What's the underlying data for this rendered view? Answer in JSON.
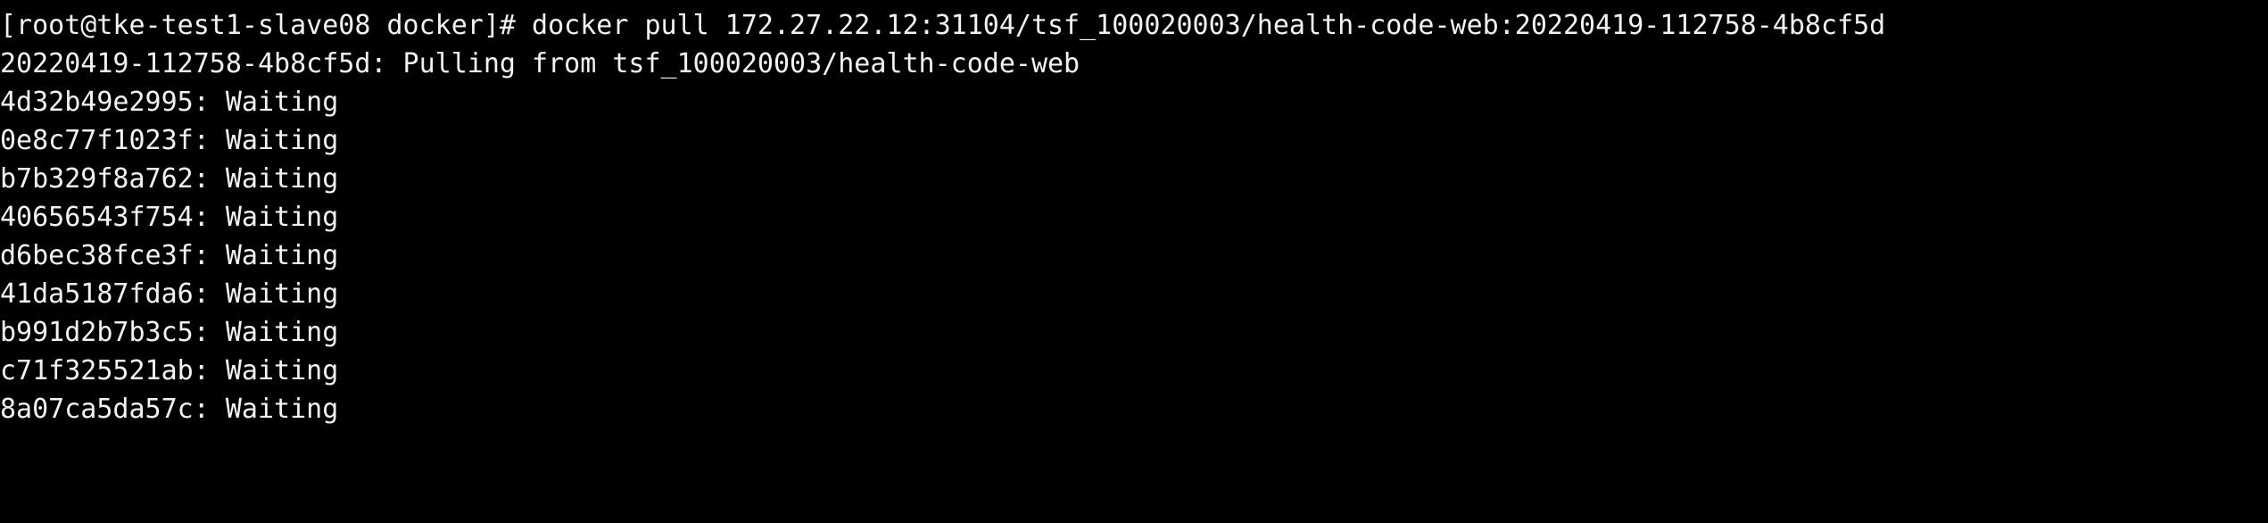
{
  "terminal": {
    "prompt": "[root@tke-test1-slave08 docker]# ",
    "command": "docker pull 172.27.22.12:31104/tsf_100020003/health-code-web:20220419-112758-4b8cf5d",
    "pulling_line": "20220419-112758-4b8cf5d: Pulling from tsf_100020003/health-code-web",
    "layers": [
      {
        "id": "4d32b49e2995",
        "status": "Waiting"
      },
      {
        "id": "0e8c77f1023f",
        "status": "Waiting"
      },
      {
        "id": "b7b329f8a762",
        "status": "Waiting"
      },
      {
        "id": "40656543f754",
        "status": "Waiting"
      },
      {
        "id": "d6bec38fce3f",
        "status": "Waiting"
      },
      {
        "id": "41da5187fda6",
        "status": "Waiting"
      },
      {
        "id": "b991d2b7b3c5",
        "status": "Waiting"
      },
      {
        "id": "c71f325521ab",
        "status": "Waiting"
      },
      {
        "id": "8a07ca5da57c",
        "status": "Waiting"
      }
    ],
    "colors": {
      "background": "#000000",
      "foreground": "#f2f2f2"
    }
  }
}
